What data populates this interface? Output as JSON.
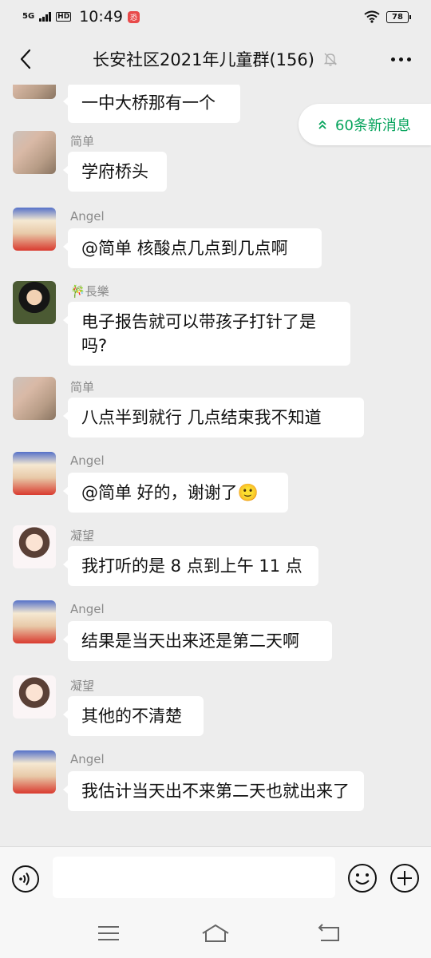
{
  "status_bar": {
    "network": "5G",
    "hd": "HD",
    "time": "10:49",
    "app_badge": "恐",
    "battery": "78"
  },
  "header": {
    "title": "长安社区2021年儿童群(156)"
  },
  "new_messages": {
    "label": "60条新消息"
  },
  "messages": [
    {
      "sender": "",
      "text": "一中大桥那有一个"
    },
    {
      "sender": "简单",
      "text": "学府桥头"
    },
    {
      "sender": "Angel",
      "text": "@简单  核酸点几点到几点啊"
    },
    {
      "sender": "🎋長樂",
      "text": "电子报告就可以带孩子打针了是吗?"
    },
    {
      "sender": "简单",
      "text": "八点半到就行 几点结束我不知道"
    },
    {
      "sender": "Angel",
      "text": "@简单  好的，谢谢了🙂"
    },
    {
      "sender": "凝望",
      "text": "我打听的是 8 点到上午 11 点"
    },
    {
      "sender": "Angel",
      "text": "结果是当天出来还是第二天啊"
    },
    {
      "sender": "凝望",
      "text": "其他的不清楚"
    },
    {
      "sender": "Angel",
      "text": "我估计当天出不来第二天也就出来了"
    }
  ],
  "input": {
    "placeholder": ""
  },
  "colors": {
    "accent_green": "#07a45d",
    "chat_bg": "#ededed"
  }
}
